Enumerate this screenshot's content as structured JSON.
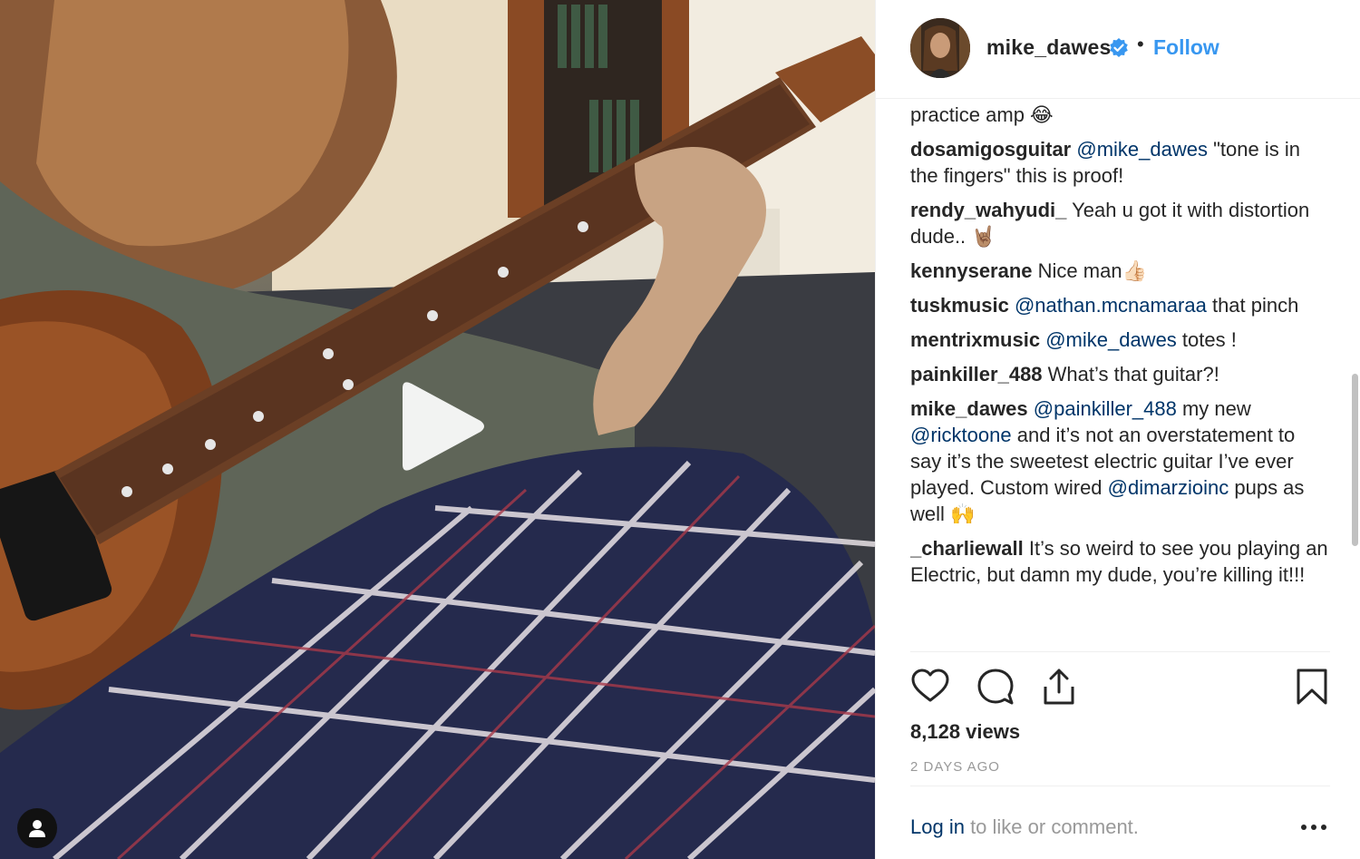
{
  "header": {
    "username": "mike_dawes",
    "separator": "•",
    "follow_label": "Follow"
  },
  "comments": [
    {
      "text": "practice amp 😂"
    },
    {
      "user": "dosamigosguitar",
      "mention": "@mike_dawes",
      "text": " \"tone is in the fingers\" this is proof!"
    },
    {
      "user": "rendy_wahyudi_",
      "text": "Yeah u got it with distortion dude.. 🤘🏽"
    },
    {
      "user": "kennyserane",
      "text": "Nice man👍🏻"
    },
    {
      "user": "tuskmusic",
      "mention": "@nathan.mcnamaraa",
      "text": " that pinch"
    },
    {
      "user": "mentrixmusic",
      "mention": "@mike_dawes",
      "text": " totes !"
    },
    {
      "user": "painkiller_488",
      "text": "What’s that guitar?!"
    },
    {
      "user": "mike_dawes",
      "mention": "@painkiller_488",
      "text_a": " my new ",
      "mention2": "@ricktoone",
      "text_b": " and it’s not an overstatement to say it’s the sweetest electric guitar I’ve ever played. Custom wired ",
      "mention3": "@dimarzioinc",
      "text_c": " pups as well 🙌"
    },
    {
      "user": "_charliewall",
      "text": "It’s so weird to see you playing an Electric, but damn my dude, you’re killing it!!!"
    }
  ],
  "stats": {
    "views": "8,128 views",
    "date": "2 DAYS AGO"
  },
  "footer": {
    "login_link": "Log in",
    "login_rest": " to like or comment.",
    "more": "•••"
  },
  "colors": {
    "accent": "#3897f0",
    "mention": "#003569",
    "muted": "#999999",
    "text": "#262626"
  },
  "icons": [
    "play-icon",
    "user-tag-icon",
    "verified-icon",
    "heart-icon",
    "comment-icon",
    "share-icon",
    "bookmark-icon",
    "more-icon"
  ]
}
